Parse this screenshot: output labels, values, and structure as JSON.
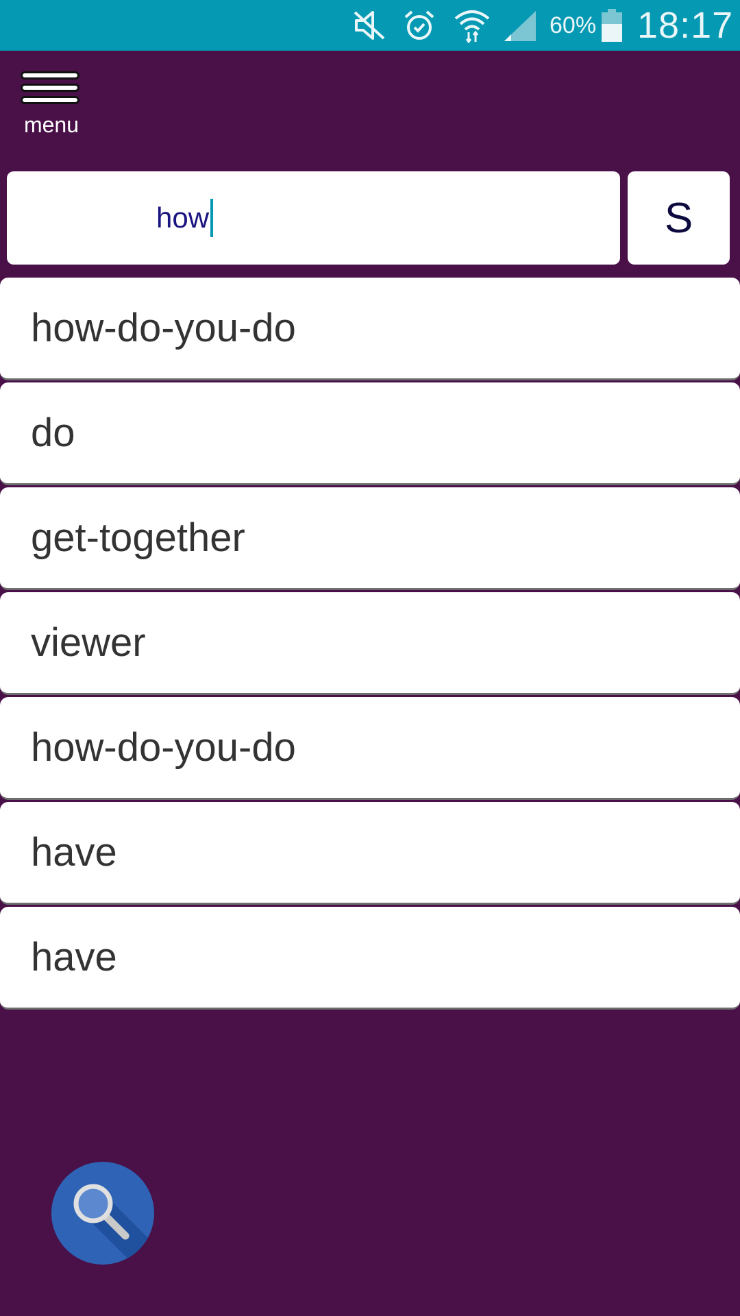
{
  "status_bar": {
    "battery_percent": "60%",
    "time": "18:17",
    "icons": [
      "mute-icon",
      "alarm-icon",
      "wifi-icon",
      "signal-icon",
      "battery-icon"
    ],
    "background_color": "#0599b3"
  },
  "menu": {
    "label": "menu"
  },
  "search": {
    "value": "how",
    "button_label": "S"
  },
  "suggestions": [
    "how-do-you-do",
    "do",
    "get-together",
    "viewer",
    "how-do-you-do",
    "have",
    "have"
  ],
  "fab": {
    "icon": "search-icon",
    "color": "#2e63b5"
  },
  "theme": {
    "background": "#4a1149",
    "card": "#ffffff",
    "input_text": "#1a1580"
  }
}
